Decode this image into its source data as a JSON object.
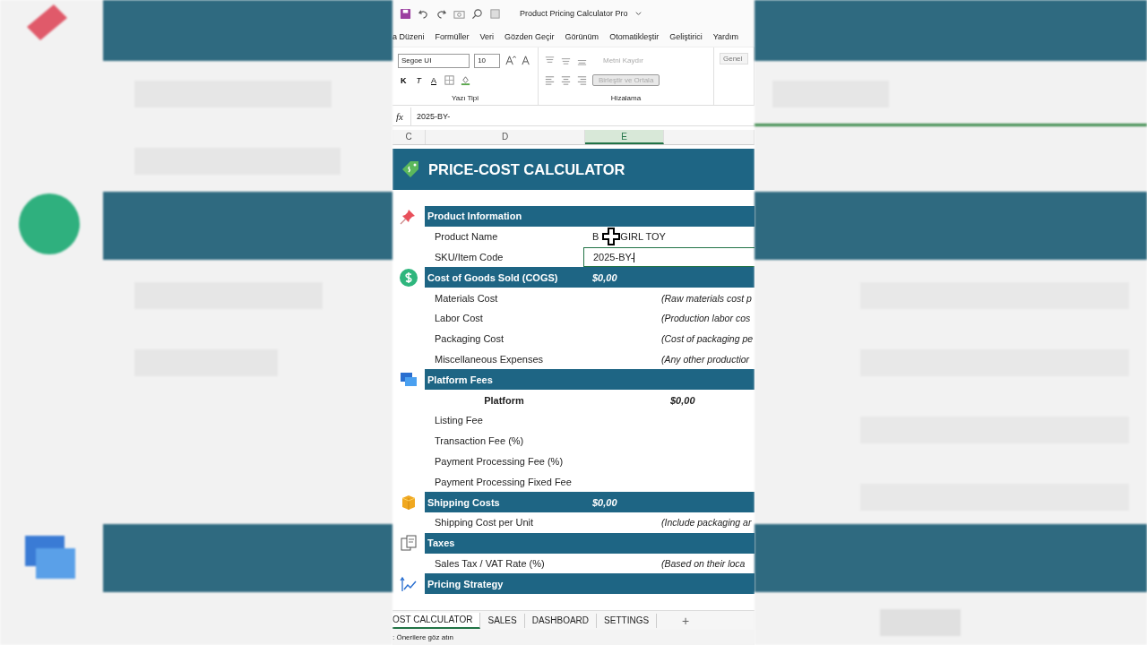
{
  "window": {
    "title": "Product Pricing Calculator Pro"
  },
  "menu": [
    {
      "label": "a Düzeni"
    },
    {
      "label": "Formüller"
    },
    {
      "label": "Veri"
    },
    {
      "label": "Gözden Geçir"
    },
    {
      "label": "Görünüm"
    },
    {
      "label": "Otomatikleştir"
    },
    {
      "label": "Geliştirici"
    },
    {
      "label": "Yardım"
    }
  ],
  "ribbon": {
    "font_name": "Segoe UI",
    "font_size": "10",
    "bold": "K",
    "italic": "T",
    "font_color": "A",
    "font_group": "Yazı Tipi",
    "wrap_text": "Metni Kaydır",
    "merge": "Birleştir ve Ortala",
    "align_group": "Hizalama",
    "number_format": "Genel"
  },
  "formula_bar": {
    "fx": "fx",
    "value": "2025-BY-"
  },
  "columns": [
    {
      "label": "C",
      "selected": false
    },
    {
      "label": "D",
      "selected": false
    },
    {
      "label": "E",
      "selected": true
    },
    {
      "selected": false
    }
  ],
  "sheet_title": "PRICE-COST CALCULATOR",
  "rows": [
    {
      "kind": "section",
      "label": "Product Information"
    },
    {
      "kind": "field",
      "label": "Product Name",
      "value_parts": [
        "B",
        "GIRL TOY"
      ],
      "cursor": true
    },
    {
      "kind": "field",
      "label": "SKU/Item Code",
      "value": "2025-BY-",
      "editing": true
    },
    {
      "kind": "section",
      "label": "Cost of Goods Sold (COGS)",
      "total": "$0,00"
    },
    {
      "kind": "field",
      "label": "Materials Cost",
      "note": "(Raw materials cost p"
    },
    {
      "kind": "field",
      "label": "Labor Cost",
      "note": "(Production labor cos"
    },
    {
      "kind": "field",
      "label": "Packaging Cost",
      "note": "(Cost of packaging pe"
    },
    {
      "kind": "field",
      "label": "Miscellaneous Expenses",
      "note": "(Any other productior"
    },
    {
      "kind": "section",
      "label": "Platform Fees"
    },
    {
      "kind": "sub",
      "label": "Platform",
      "amount": "$0,00"
    },
    {
      "kind": "field",
      "label": "Listing Fee"
    },
    {
      "kind": "field",
      "label": "Transaction Fee (%)"
    },
    {
      "kind": "field",
      "label": "Payment Processing Fee (%)"
    },
    {
      "kind": "field",
      "label": "Payment Processing Fixed Fee"
    },
    {
      "kind": "section",
      "label": "Shipping Costs",
      "total": "$0,00"
    },
    {
      "kind": "field",
      "label": "Shipping Cost per Unit",
      "note": "(Include packaging ar"
    },
    {
      "kind": "section",
      "label": "Taxes"
    },
    {
      "kind": "field",
      "label": "Sales Tax / VAT Rate (%)",
      "note": "(Based on their loca"
    },
    {
      "kind": "section",
      "label": "Pricing Strategy"
    }
  ],
  "sheet_tabs": [
    {
      "label": "OST CALCULATOR",
      "selected": true
    },
    {
      "label": "SALES",
      "selected": false
    },
    {
      "label": "DASHBOARD",
      "selected": false
    },
    {
      "label": "SETTINGS",
      "selected": false
    }
  ],
  "add_sheet": "+",
  "status_bar": ": Önerilere göz atın"
}
